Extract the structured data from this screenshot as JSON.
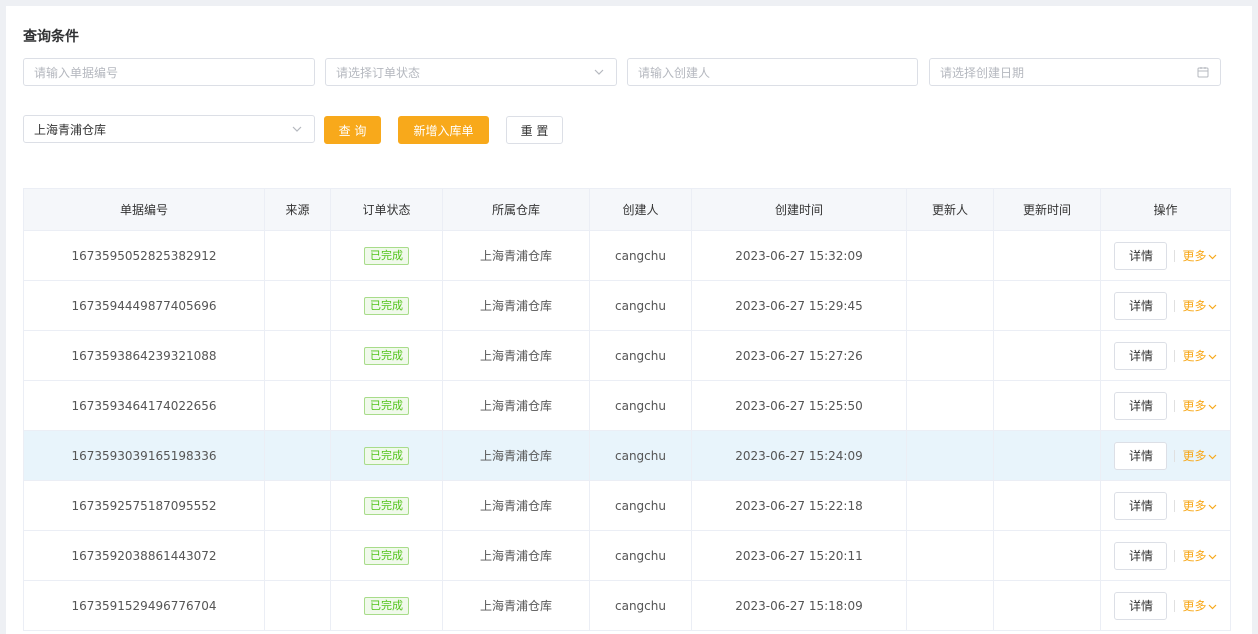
{
  "query": {
    "title": "查询条件",
    "order_no_placeholder": "请输入单据编号",
    "status_placeholder": "请选择订单状态",
    "creator_placeholder": "请输入创建人",
    "date_placeholder": "请选择创建日期",
    "warehouse_value": "上海青浦仓库",
    "search_label": "查 询",
    "add_label": "新增入库单",
    "reset_label": "重 置"
  },
  "table": {
    "columns": [
      "单据编号",
      "来源",
      "订单状态",
      "所属仓库",
      "创建人",
      "创建时间",
      "更新人",
      "更新时间",
      "操作"
    ],
    "detail_label": "详情",
    "more_label": "更多",
    "rows": [
      {
        "no": "1673595052825382912",
        "source": "",
        "status": "已完成",
        "warehouse": "上海青浦仓库",
        "creator": "cangchu",
        "created": "2023-06-27 15:32:09",
        "updater": "",
        "updated": ""
      },
      {
        "no": "1673594449877405696",
        "source": "",
        "status": "已完成",
        "warehouse": "上海青浦仓库",
        "creator": "cangchu",
        "created": "2023-06-27 15:29:45",
        "updater": "",
        "updated": ""
      },
      {
        "no": "1673593864239321088",
        "source": "",
        "status": "已完成",
        "warehouse": "上海青浦仓库",
        "creator": "cangchu",
        "created": "2023-06-27 15:27:26",
        "updater": "",
        "updated": ""
      },
      {
        "no": "1673593464174022656",
        "source": "",
        "status": "已完成",
        "warehouse": "上海青浦仓库",
        "creator": "cangchu",
        "created": "2023-06-27 15:25:50",
        "updater": "",
        "updated": ""
      },
      {
        "no": "1673593039165198336",
        "source": "",
        "status": "已完成",
        "warehouse": "上海青浦仓库",
        "creator": "cangchu",
        "created": "2023-06-27 15:24:09",
        "updater": "",
        "updated": ""
      },
      {
        "no": "1673592575187095552",
        "source": "",
        "status": "已完成",
        "warehouse": "上海青浦仓库",
        "creator": "cangchu",
        "created": "2023-06-27 15:22:18",
        "updater": "",
        "updated": ""
      },
      {
        "no": "1673592038861443072",
        "source": "",
        "status": "已完成",
        "warehouse": "上海青浦仓库",
        "creator": "cangchu",
        "created": "2023-06-27 15:20:11",
        "updater": "",
        "updated": ""
      },
      {
        "no": "1673591529496776704",
        "source": "",
        "status": "已完成",
        "warehouse": "上海青浦仓库",
        "creator": "cangchu",
        "created": "2023-06-27 15:18:09",
        "updater": "",
        "updated": ""
      }
    ]
  },
  "colors": {
    "accent": "#f8a91b",
    "success": "#52c41a",
    "highlight_row": "#e8f4fb"
  }
}
